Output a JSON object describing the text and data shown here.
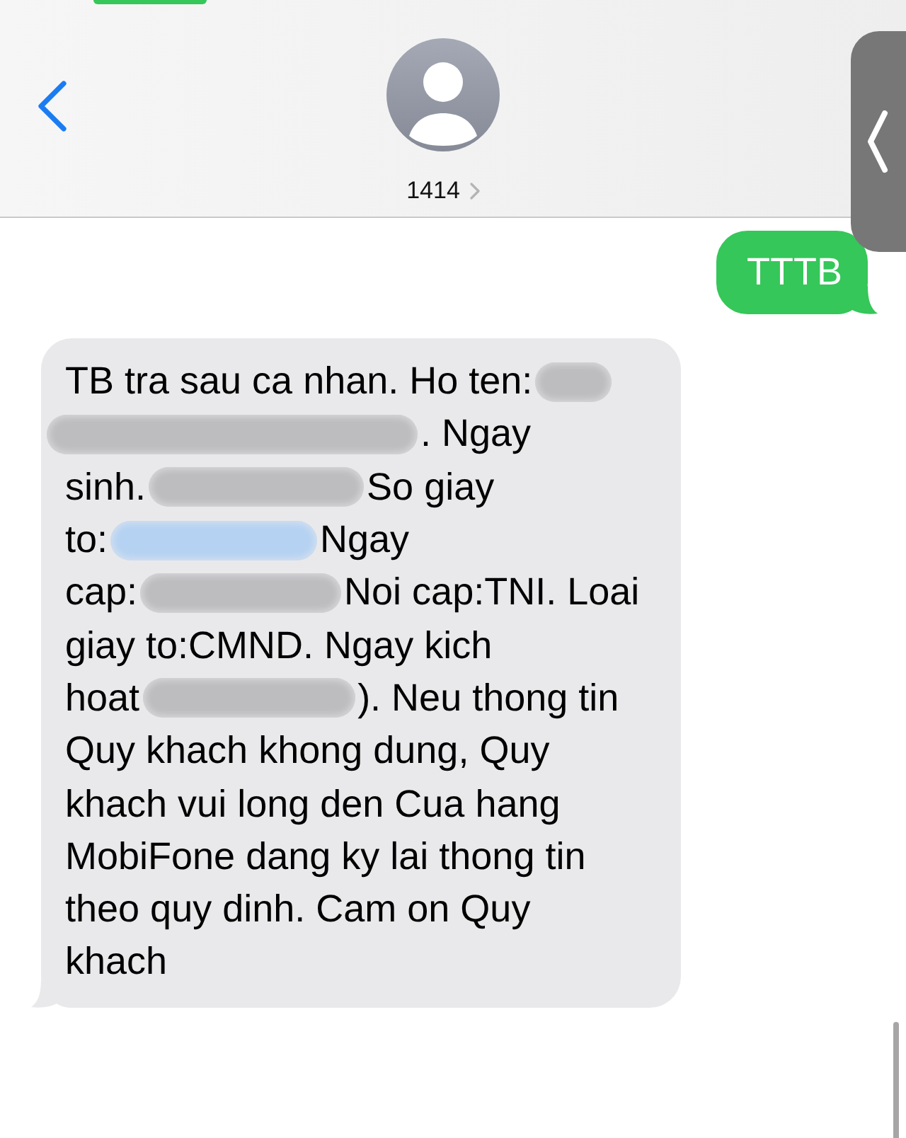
{
  "header": {
    "contact": "1414"
  },
  "messages": [
    {
      "kind": "sent",
      "lines": [
        [
          {
            "kind": "text",
            "text": "TTTB"
          }
        ]
      ]
    },
    {
      "kind": "received",
      "lines": [
        [
          {
            "kind": "text",
            "text": "TB tra sau ca nhan. Ho ten:"
          },
          {
            "kind": "redacted",
            "color": "#bdbdc0"
          }
        ],
        [
          {
            "kind": "redacted",
            "color": "#bdbdc0"
          },
          {
            "kind": "text",
            "text": ". Ngay"
          }
        ],
        [
          {
            "kind": "text",
            "text": "sinh."
          },
          {
            "kind": "redacted",
            "color": "#bdbdc0"
          },
          {
            "kind": "text",
            "text": "So giay"
          }
        ],
        [
          {
            "kind": "text",
            "text": "to:"
          },
          {
            "kind": "redacted",
            "color": "#b5d2f3"
          },
          {
            "kind": "text",
            "text": "Ngay"
          }
        ],
        [
          {
            "kind": "text",
            "text": "cap:"
          },
          {
            "kind": "redacted",
            "color": "#bdbdc0"
          },
          {
            "kind": "text",
            "text": "Noi cap:TNI. Loai"
          }
        ],
        [
          {
            "kind": "text",
            "text": "giay to:CMND. Ngay kich"
          }
        ],
        [
          {
            "kind": "text",
            "text": "hoat"
          },
          {
            "kind": "redacted",
            "color": "#bdbdc0"
          },
          {
            "kind": "text",
            "text": "). Neu thong tin"
          }
        ],
        [
          {
            "kind": "text",
            "text": "Quy khach khong dung, Quy"
          }
        ],
        [
          {
            "kind": "text",
            "text": "khach vui long den Cua hang"
          }
        ],
        [
          {
            "kind": "text",
            "text": "MobiFone dang ky lai thong tin"
          }
        ],
        [
          {
            "kind": "text",
            "text": "theo quy dinh. Cam on Quy"
          }
        ],
        [
          {
            "kind": "text",
            "text": "khach"
          }
        ]
      ]
    }
  ]
}
